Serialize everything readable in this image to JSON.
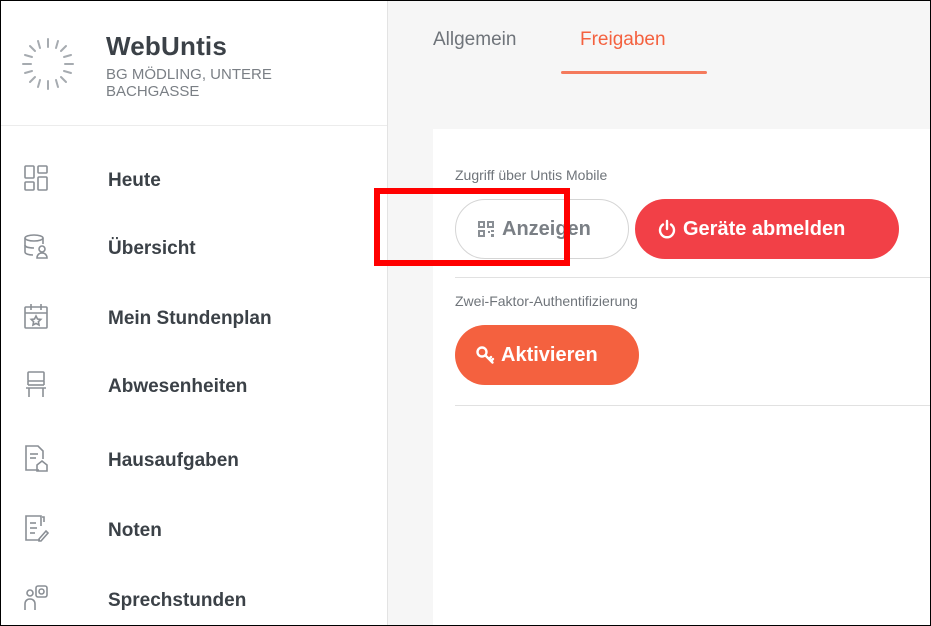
{
  "app": {
    "name": "WebUntis",
    "school": "BG MÖDLING, UNTERE BACHGASSE"
  },
  "sidebar": {
    "items": [
      {
        "label": "Heute",
        "icon": "dashboard-icon"
      },
      {
        "label": "Übersicht",
        "icon": "database-user-icon"
      },
      {
        "label": "Mein Stundenplan",
        "icon": "calendar-star-icon"
      },
      {
        "label": "Abwesenheiten",
        "icon": "chair-icon"
      },
      {
        "label": "Hausaufgaben",
        "icon": "document-house-icon"
      },
      {
        "label": "Noten",
        "icon": "document-pen-icon"
      },
      {
        "label": "Sprechstunden",
        "icon": "person-speech-icon"
      }
    ]
  },
  "tabs": [
    {
      "label": "Allgemein",
      "active": false
    },
    {
      "label": "Freigaben",
      "active": true
    }
  ],
  "sections": {
    "mobile_access": {
      "label": "Zugriff über Untis Mobile",
      "show_button": "Anzeigen",
      "logout_button": "Geräte abmelden"
    },
    "two_factor": {
      "label": "Zwei-Faktor-Authentifizierung",
      "activate_button": "Aktivieren"
    }
  },
  "colors": {
    "accent_orange": "#f4613f",
    "danger_red": "#f24047",
    "highlight_red": "#ff0000",
    "text_dark": "#3b4147",
    "text_muted": "#6f747a"
  }
}
